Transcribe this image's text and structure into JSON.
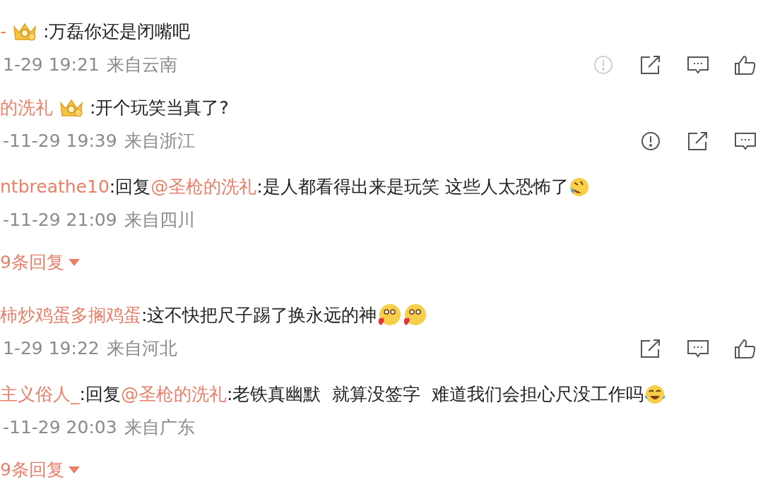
{
  "threads": [
    {
      "author": "-",
      "crown": true,
      "text": ":万磊你还是闭嘴吧",
      "time": "1-29 19:21",
      "location": "来自云南",
      "actions": [
        {
          "kind": "report",
          "dim": true
        },
        {
          "kind": "share",
          "dim": false
        },
        {
          "kind": "comment",
          "dim": false
        },
        {
          "kind": "like",
          "dim": false
        }
      ]
    },
    {
      "author": "的洗礼",
      "crown": true,
      "text": ":开个玩笑当真了?",
      "time": "-11-29 19:39",
      "location": "来自浙江",
      "actions": [
        {
          "kind": "report",
          "dim": false
        },
        {
          "kind": "share",
          "dim": false
        },
        {
          "kind": "comment",
          "dim": false
        }
      ],
      "replies": [
        {
          "author": "ntbreathe10",
          "prefix": ":回复",
          "mention": "@圣枪的洗礼",
          "text": ":是人都看得出来是玩笑 这些人太恐怖了",
          "emojis": [
            {
              "kind": "laugh-cry"
            }
          ],
          "time": "-11-29 21:09",
          "location": "来自四川"
        }
      ],
      "more": "9条回复"
    },
    {
      "author": "柿炒鸡蛋多搁鸡蛋",
      "crown": false,
      "text": ":这不快把尺子踢了换永远的神",
      "emojis": [
        {
          "kind": "heart-hug"
        },
        {
          "kind": "heart-hug"
        }
      ],
      "time": "1-29 19:22",
      "location": "来自河北",
      "actions": [
        {
          "kind": "share",
          "dim": false
        },
        {
          "kind": "comment",
          "dim": false
        },
        {
          "kind": "like",
          "dim": false
        }
      ],
      "replies": [
        {
          "author": "主义俗人_",
          "prefix": ":回复",
          "mention": "@圣枪的洗礼",
          "text": ":老铁真幽默  就算没签字  难道我们会担心尺没工作吗",
          "emojis": [
            {
              "kind": "tears-of-joy"
            }
          ],
          "time": "-11-29 20:03",
          "location": "来自广东"
        }
      ],
      "more": "9条回复"
    }
  ]
}
